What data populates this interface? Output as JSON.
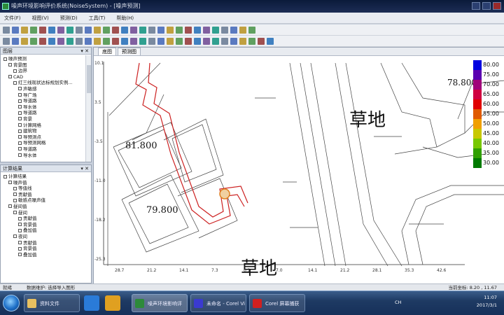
{
  "window": {
    "title": "噪声环境影响评价系统(NoiseSystem) - [噪声预测]"
  },
  "menu": [
    "文件(F)",
    "视图(V)",
    "预测(D)",
    "工具(T)",
    "帮助(H)"
  ],
  "panel_layers": {
    "title": "图层",
    "items": [
      "噪声预测",
      "背景图",
      "边界",
      "CAD",
      "红三线现状达标规划实例...",
      "声敏感",
      "导广场",
      "导道路",
      "导水体",
      "导道路",
      "背景",
      "计算网格",
      "建筑物",
      "导预测点",
      "导预测网格",
      "导道路",
      "导水体"
    ]
  },
  "panel_calc": {
    "title": "计算结果",
    "items": [
      "计算结果",
      "噪声值",
      "等值线",
      "贡献值",
      "敏感点噪声值",
      "昼间值",
      "昼间",
      "贡献值",
      "背景值",
      "叠加值",
      "夜间",
      "贡献值",
      "背景值",
      "叠加值"
    ]
  },
  "tabs": [
    "底图",
    "预测图"
  ],
  "map": {
    "labels": [
      {
        "text": "草地",
        "kind": "area"
      },
      {
        "text": "草地",
        "kind": "area"
      },
      {
        "text": "78.800",
        "kind": "elevation"
      },
      {
        "text": "81.800",
        "kind": "elevation"
      },
      {
        "text": "79.800",
        "kind": "elevation"
      }
    ],
    "y_ticks": [
      "10.1",
      "3.5",
      "-3.5",
      "-11.0",
      "-18.2",
      "-25.3"
    ],
    "x_ticks": [
      "28.7",
      "21.2",
      "14.1",
      "7.3",
      "0.1",
      "7.0",
      "14.1",
      "21.2",
      "28.1",
      "35.3",
      "42.6"
    ]
  },
  "legend": {
    "values": [
      "80.00",
      "75.00",
      "70.00",
      "65.00",
      "60.00",
      "55.00",
      "50.00",
      "45.00",
      "40.00",
      "35.00",
      "30.00"
    ],
    "colors": [
      "#0000e0",
      "#5a00b0",
      "#a0007a",
      "#d00040",
      "#e00000",
      "#e05a00",
      "#f0a000",
      "#c8c800",
      "#78c800",
      "#30a000",
      "#007a00"
    ]
  },
  "status": {
    "left": "就绪",
    "message": "数据维护: 选择导入图形",
    "coords": "当前坐标: 8.20 , 11.67"
  },
  "taskbar": {
    "buttons": [
      "资料文件",
      "噪声环境影响评",
      "未命名 - Corel Vi",
      "Corel 屏幕捕获"
    ],
    "tray_lang": "CH",
    "time": "11:07",
    "date": "2017/3/1"
  }
}
